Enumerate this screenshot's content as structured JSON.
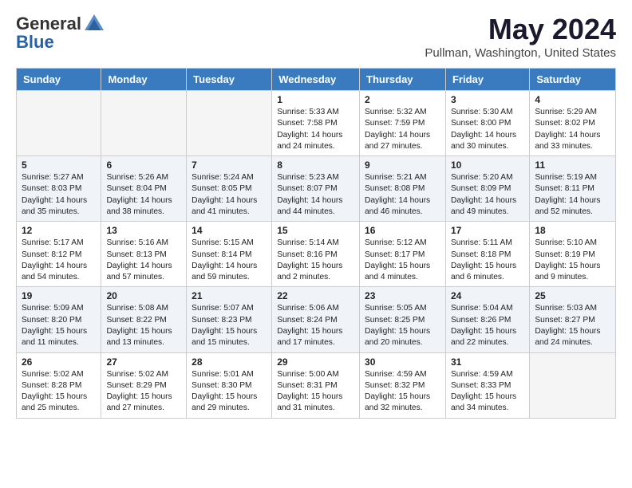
{
  "logo": {
    "general": "General",
    "blue": "Blue"
  },
  "header": {
    "month": "May 2024",
    "location": "Pullman, Washington, United States"
  },
  "weekdays": [
    "Sunday",
    "Monday",
    "Tuesday",
    "Wednesday",
    "Thursday",
    "Friday",
    "Saturday"
  ],
  "weeks": [
    [
      {
        "day": "",
        "info": ""
      },
      {
        "day": "",
        "info": ""
      },
      {
        "day": "",
        "info": ""
      },
      {
        "day": "1",
        "info": "Sunrise: 5:33 AM\nSunset: 7:58 PM\nDaylight: 14 hours\nand 24 minutes."
      },
      {
        "day": "2",
        "info": "Sunrise: 5:32 AM\nSunset: 7:59 PM\nDaylight: 14 hours\nand 27 minutes."
      },
      {
        "day": "3",
        "info": "Sunrise: 5:30 AM\nSunset: 8:00 PM\nDaylight: 14 hours\nand 30 minutes."
      },
      {
        "day": "4",
        "info": "Sunrise: 5:29 AM\nSunset: 8:02 PM\nDaylight: 14 hours\nand 33 minutes."
      }
    ],
    [
      {
        "day": "5",
        "info": "Sunrise: 5:27 AM\nSunset: 8:03 PM\nDaylight: 14 hours\nand 35 minutes."
      },
      {
        "day": "6",
        "info": "Sunrise: 5:26 AM\nSunset: 8:04 PM\nDaylight: 14 hours\nand 38 minutes."
      },
      {
        "day": "7",
        "info": "Sunrise: 5:24 AM\nSunset: 8:05 PM\nDaylight: 14 hours\nand 41 minutes."
      },
      {
        "day": "8",
        "info": "Sunrise: 5:23 AM\nSunset: 8:07 PM\nDaylight: 14 hours\nand 44 minutes."
      },
      {
        "day": "9",
        "info": "Sunrise: 5:21 AM\nSunset: 8:08 PM\nDaylight: 14 hours\nand 46 minutes."
      },
      {
        "day": "10",
        "info": "Sunrise: 5:20 AM\nSunset: 8:09 PM\nDaylight: 14 hours\nand 49 minutes."
      },
      {
        "day": "11",
        "info": "Sunrise: 5:19 AM\nSunset: 8:11 PM\nDaylight: 14 hours\nand 52 minutes."
      }
    ],
    [
      {
        "day": "12",
        "info": "Sunrise: 5:17 AM\nSunset: 8:12 PM\nDaylight: 14 hours\nand 54 minutes."
      },
      {
        "day": "13",
        "info": "Sunrise: 5:16 AM\nSunset: 8:13 PM\nDaylight: 14 hours\nand 57 minutes."
      },
      {
        "day": "14",
        "info": "Sunrise: 5:15 AM\nSunset: 8:14 PM\nDaylight: 14 hours\nand 59 minutes."
      },
      {
        "day": "15",
        "info": "Sunrise: 5:14 AM\nSunset: 8:16 PM\nDaylight: 15 hours\nand 2 minutes."
      },
      {
        "day": "16",
        "info": "Sunrise: 5:12 AM\nSunset: 8:17 PM\nDaylight: 15 hours\nand 4 minutes."
      },
      {
        "day": "17",
        "info": "Sunrise: 5:11 AM\nSunset: 8:18 PM\nDaylight: 15 hours\nand 6 minutes."
      },
      {
        "day": "18",
        "info": "Sunrise: 5:10 AM\nSunset: 8:19 PM\nDaylight: 15 hours\nand 9 minutes."
      }
    ],
    [
      {
        "day": "19",
        "info": "Sunrise: 5:09 AM\nSunset: 8:20 PM\nDaylight: 15 hours\nand 11 minutes."
      },
      {
        "day": "20",
        "info": "Sunrise: 5:08 AM\nSunset: 8:22 PM\nDaylight: 15 hours\nand 13 minutes."
      },
      {
        "day": "21",
        "info": "Sunrise: 5:07 AM\nSunset: 8:23 PM\nDaylight: 15 hours\nand 15 minutes."
      },
      {
        "day": "22",
        "info": "Sunrise: 5:06 AM\nSunset: 8:24 PM\nDaylight: 15 hours\nand 17 minutes."
      },
      {
        "day": "23",
        "info": "Sunrise: 5:05 AM\nSunset: 8:25 PM\nDaylight: 15 hours\nand 20 minutes."
      },
      {
        "day": "24",
        "info": "Sunrise: 5:04 AM\nSunset: 8:26 PM\nDaylight: 15 hours\nand 22 minutes."
      },
      {
        "day": "25",
        "info": "Sunrise: 5:03 AM\nSunset: 8:27 PM\nDaylight: 15 hours\nand 24 minutes."
      }
    ],
    [
      {
        "day": "26",
        "info": "Sunrise: 5:02 AM\nSunset: 8:28 PM\nDaylight: 15 hours\nand 25 minutes."
      },
      {
        "day": "27",
        "info": "Sunrise: 5:02 AM\nSunset: 8:29 PM\nDaylight: 15 hours\nand 27 minutes."
      },
      {
        "day": "28",
        "info": "Sunrise: 5:01 AM\nSunset: 8:30 PM\nDaylight: 15 hours\nand 29 minutes."
      },
      {
        "day": "29",
        "info": "Sunrise: 5:00 AM\nSunset: 8:31 PM\nDaylight: 15 hours\nand 31 minutes."
      },
      {
        "day": "30",
        "info": "Sunrise: 4:59 AM\nSunset: 8:32 PM\nDaylight: 15 hours\nand 32 minutes."
      },
      {
        "day": "31",
        "info": "Sunrise: 4:59 AM\nSunset: 8:33 PM\nDaylight: 15 hours\nand 34 minutes."
      },
      {
        "day": "",
        "info": ""
      }
    ]
  ]
}
